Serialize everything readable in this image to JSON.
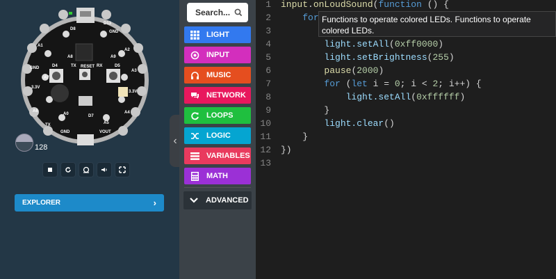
{
  "board": {
    "labels": {
      "d13": "D13",
      "d8": "D8",
      "gnd_top": "GND",
      "a8": "A8",
      "a9": "A9",
      "d4": "D4",
      "d5": "D5",
      "tx": "TX",
      "reset": "RESET",
      "rx": "RX",
      "a1": "A1",
      "a2": "A2",
      "a3": "A3",
      "a4": "A4",
      "a5": "A5",
      "a6": "A6",
      "a7": "A7",
      "a0": "A0",
      "d7": "D7",
      "tx_a6": "TX",
      "gnd_left": "GND",
      "gnd_right": "GND",
      "vout": "VOUT",
      "v33_left": "3.3V",
      "v33_right": "3.3V"
    },
    "temperature": "128"
  },
  "explorer": {
    "label": "EXPLORER"
  },
  "search": {
    "placeholder": "Search..."
  },
  "categories": [
    {
      "label": "LIGHT",
      "color": "#3279ef"
    },
    {
      "label": "INPUT",
      "color": "#d32ebd"
    },
    {
      "label": "MUSIC",
      "color": "#e54e1f"
    },
    {
      "label": "NETWORK",
      "color": "#e8185d"
    },
    {
      "label": "LOOPS",
      "color": "#1fbf3f"
    },
    {
      "label": "LOGIC",
      "color": "#05a5d1"
    },
    {
      "label": "VARIABLES",
      "color": "#e93a5e"
    },
    {
      "label": "MATH",
      "color": "#9b30d6"
    }
  ],
  "advanced": {
    "label": "ADVANCED"
  },
  "editor": {
    "lines": [
      {
        "n": "1",
        "text": "input.onLoudSound(function () {"
      },
      {
        "n": "2",
        "text": "    for"
      },
      {
        "n": "3",
        "text": ""
      },
      {
        "n": "4",
        "text": "        light.setAll(0xff0000)"
      },
      {
        "n": "5",
        "text": "        light.setBrightness(255)"
      },
      {
        "n": "6",
        "text": "        pause(2000)"
      },
      {
        "n": "7",
        "text": "        for (let i = 0; i < 2; i++) {"
      },
      {
        "n": "8",
        "text": "            light.setAll(0xffffff)"
      },
      {
        "n": "9",
        "text": "        }"
      },
      {
        "n": "10",
        "text": "        light.clear()"
      },
      {
        "n": "11",
        "text": "    }"
      },
      {
        "n": "12",
        "text": "})"
      },
      {
        "n": "13",
        "text": ""
      }
    ],
    "tooltip": "Functions to operate colored LEDs. Functions to operate colored LEDs."
  }
}
